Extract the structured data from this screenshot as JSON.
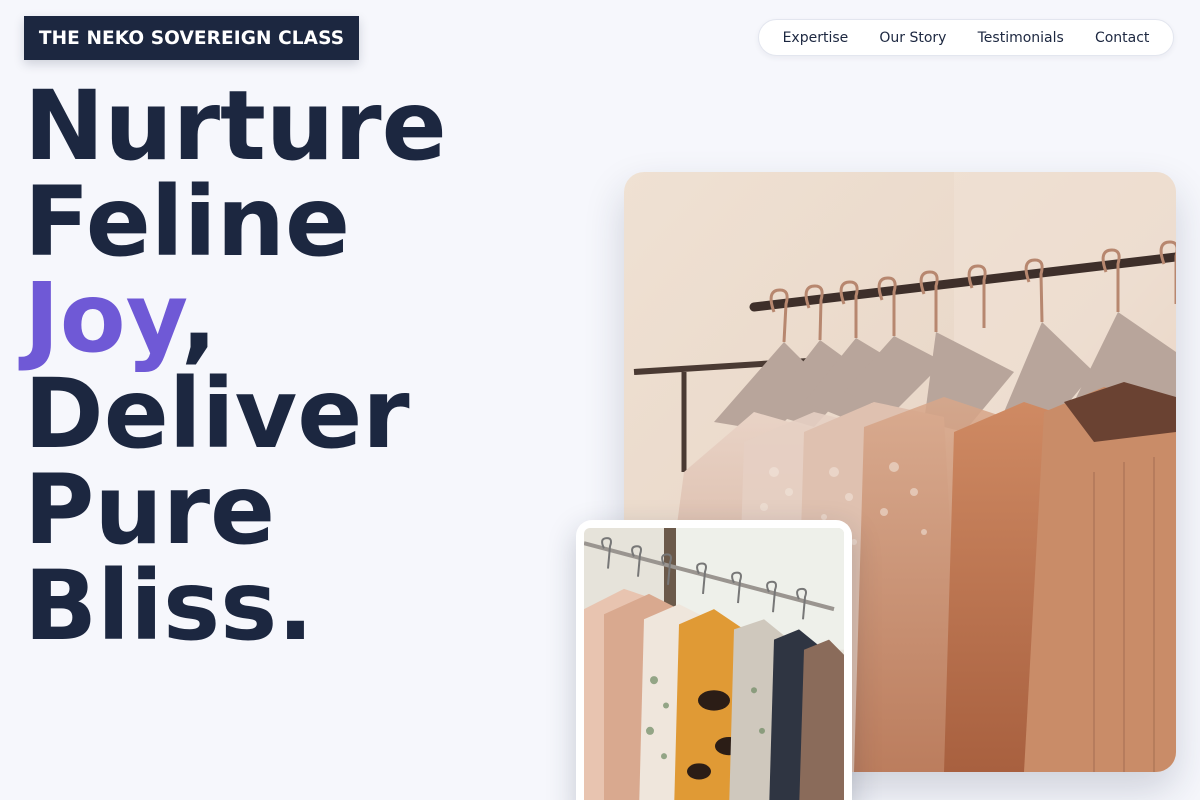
{
  "brand": {
    "name": "THE NEKO SOVEREIGN CLASS"
  },
  "nav": {
    "items": [
      {
        "label": "Expertise"
      },
      {
        "label": "Our Story"
      },
      {
        "label": "Testimonials"
      },
      {
        "label": "Contact"
      }
    ]
  },
  "hero": {
    "line1": "Nurture",
    "line2": "Feline",
    "line3_accent": "Joy",
    "line3_rest": ",",
    "line4": "Deliver",
    "line5": "Pure",
    "line6": "Bliss."
  },
  "colors": {
    "navy": "#1c2740",
    "accent_purple": "#6f59d6",
    "background": "#f6f7fc"
  },
  "images": {
    "main": {
      "depicts": "clothing-rack-photo"
    },
    "inset": {
      "depicts": "clothing-rack-photo"
    }
  }
}
